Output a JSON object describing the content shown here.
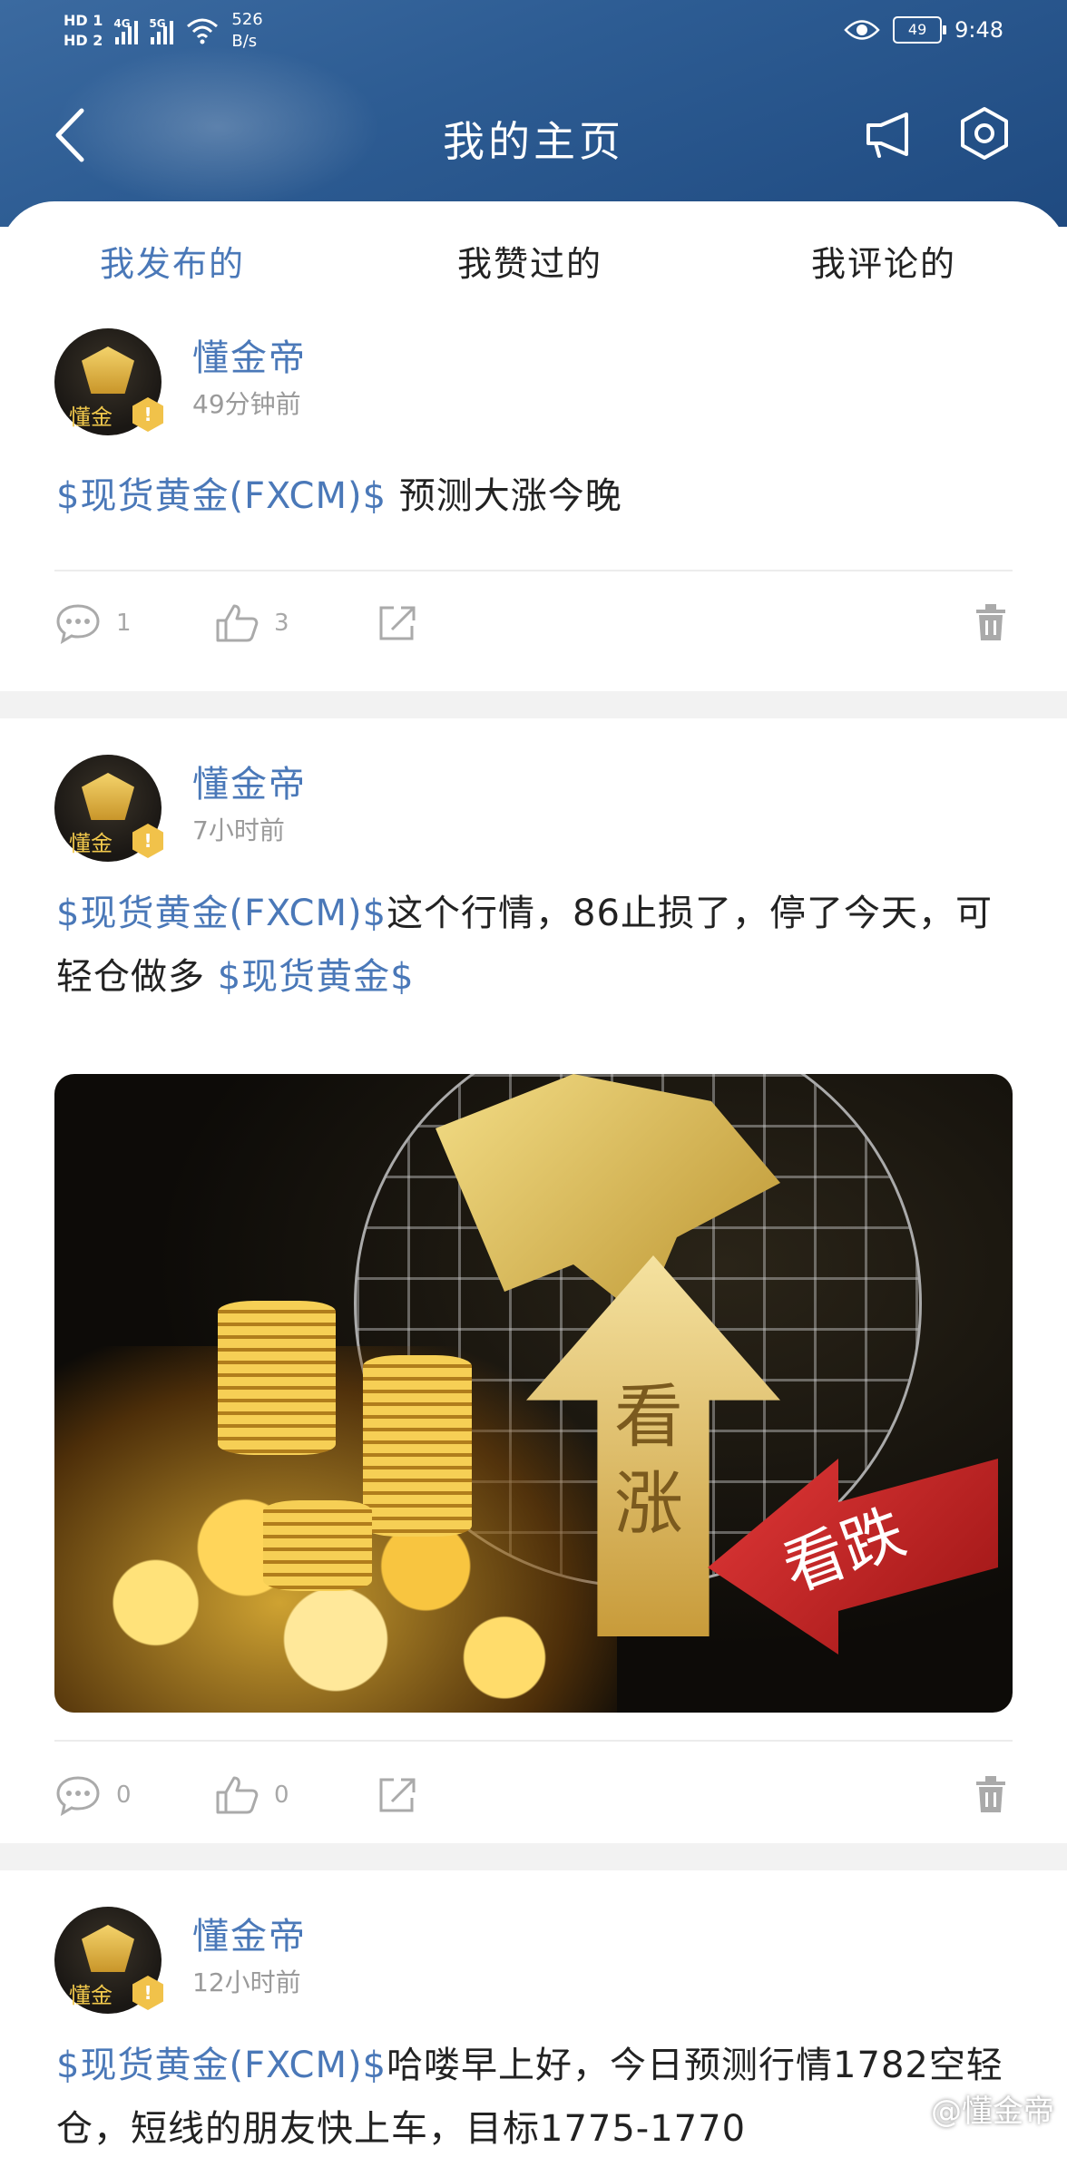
{
  "status_bar": {
    "hd1": "HD 1",
    "hd2": "HD 2",
    "net1": "4G",
    "net2": "5G",
    "net_speed_value": "526",
    "net_speed_unit": "B/s",
    "battery": "49",
    "time": "9:48"
  },
  "header": {
    "title": "我的主页",
    "icons": [
      "back-arrow-icon",
      "megaphone-icon",
      "settings-hexagon-icon"
    ]
  },
  "tabs": [
    {
      "label": "我发布的",
      "active": true
    },
    {
      "label": "我赞过的",
      "active": false
    },
    {
      "label": "我评论的",
      "active": false
    }
  ],
  "posts": [
    {
      "author": "懂金帝",
      "avatar_label": "懂金",
      "badge": "!",
      "time": "49分钟前",
      "tag": "$现货黄金(FXCM)$",
      "text": "预测大涨今晚",
      "comments": "1",
      "likes": "3"
    },
    {
      "author": "懂金帝",
      "avatar_label": "懂金",
      "badge": "!",
      "time": "7小时前",
      "tag": "$现货黄金(FXCM)$",
      "text": "这个行情，86止损了，停了今天，可轻仓做多",
      "tag2": "$现货黄金$",
      "image_text_up": "看涨",
      "image_text_down": "看跌",
      "comments": "0",
      "likes": "0"
    },
    {
      "author": "懂金帝",
      "avatar_label": "懂金",
      "badge": "!",
      "time": "12小时前",
      "tag": "$现货黄金(FXCM)$",
      "text": "哈喽早上好，今日预测行情1782空轻仓，短线的朋友快上车，目标1775-1770"
    }
  ],
  "watermark": "@懂金帝",
  "colors": {
    "accent": "#4a78b8",
    "header_bg": "#2d5c93",
    "muted": "#9a9a9a"
  }
}
